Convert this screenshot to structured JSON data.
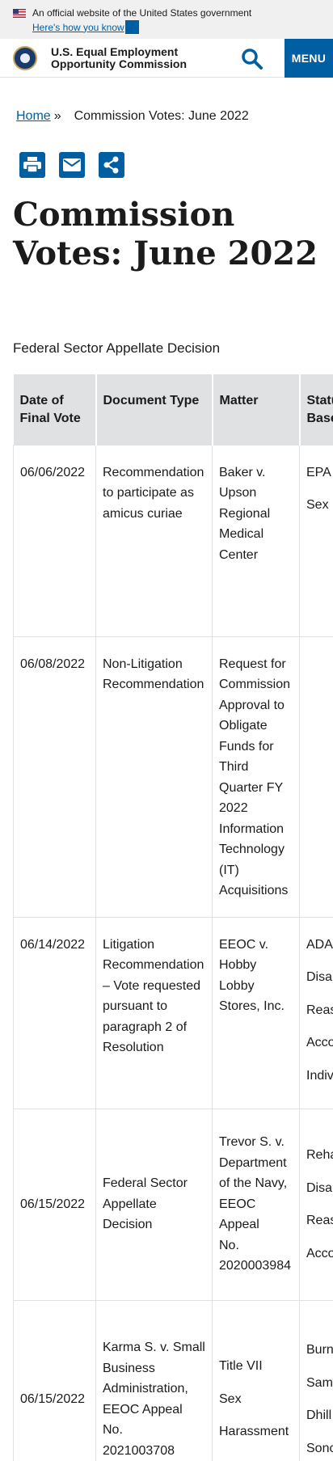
{
  "banner": {
    "official_text": "An official website of the United States government",
    "link_text": "Here's how you know"
  },
  "header": {
    "agency_line1": "U.S. Equal Employment",
    "agency_line2": "Opportunity Commission",
    "menu_label": "MENU"
  },
  "breadcrumb": {
    "home": "Home",
    "separator": "»",
    "current": "Commission Votes: June 2022"
  },
  "page": {
    "title_line1": "Commission",
    "title_line2": "Votes: June 2022",
    "caption": "Federal Sector Appellate Decision"
  },
  "table": {
    "headers": [
      "Date of Final Vote",
      "Document Type",
      "Matter",
      "Statutes / Bases"
    ],
    "header_lines": [
      [
        "Date of",
        "Final Vote"
      ],
      [
        "Document Type"
      ],
      [
        "Matter"
      ],
      [
        "Statu",
        "Base"
      ]
    ],
    "rows": [
      {
        "date": "06/06/2022",
        "type": [
          "Recommendation",
          "to participate as",
          "amicus curiae"
        ],
        "matter": [
          "Baker v.",
          "Upson",
          "Regional",
          "Medical",
          "Center"
        ],
        "bases": [
          "EPA",
          "Sex"
        ]
      },
      {
        "date": "06/08/2022",
        "type": [
          "Non-Litigation",
          "Recommendation"
        ],
        "matter": [
          "Request for",
          "Commission",
          "Approval to",
          "Obligate",
          "Funds for",
          "Third",
          "Quarter FY",
          "2022",
          "Information",
          "Technology",
          "(IT)",
          "Acquisitions"
        ],
        "bases": []
      },
      {
        "date": "06/14/2022",
        "type": [
          "Litigation",
          "Recommendation",
          "– Vote requested",
          "pursuant to",
          "paragraph 2 of",
          "Resolution"
        ],
        "matter": [
          "EEOC v.",
          "Hobby",
          "Lobby",
          "Stores, Inc."
        ],
        "bases": [
          "ADA",
          "Disal",
          "Reas",
          "Acco",
          "Indiv"
        ]
      },
      {
        "date": "06/15/2022",
        "type": [
          "Federal Sector",
          "Appellate",
          "Decision"
        ],
        "matter": [
          "Trevor S. v.",
          "Department",
          "of the Navy,",
          "EEOC Appeal",
          "No.",
          "2020003984"
        ],
        "bases": [
          "Reha",
          "Disal",
          "Reas",
          "Acco"
        ]
      },
      {
        "date": "06/15/2022",
        "type": [
          "Karma S. v. Small",
          "Business",
          "Administration,",
          "EEOC Appeal No.",
          "2021003708"
        ],
        "matter": [
          "Title VII",
          "Sex",
          "Harassment"
        ],
        "bases": [
          "Burn",
          "Sam",
          "Dhill",
          "Sonc"
        ]
      }
    ]
  }
}
